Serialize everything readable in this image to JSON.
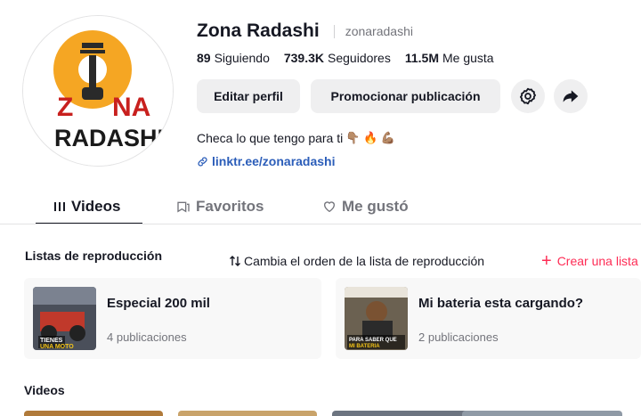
{
  "profile": {
    "display_name": "Zona Radashi",
    "username": "zonaradashi",
    "avatar_text_line1": "Z ON A",
    "avatar_text_line2": "RADASHI"
  },
  "stats": [
    {
      "value": "89",
      "label": "Siguiendo"
    },
    {
      "value": "739.3K",
      "label": "Seguidores"
    },
    {
      "value": "11.5M",
      "label": "Me gusta"
    }
  ],
  "actions": {
    "edit_label": "Editar perfil",
    "promote_label": "Promocionar publicación",
    "settings_icon": "gear-icon",
    "share_icon": "share-arrow-icon"
  },
  "bio": {
    "text": "Checa lo que tengo para ti",
    "emojis": "👇🏽 🔥 💪🏽",
    "link": "linktr.ee/zonaradashi"
  },
  "tabs": [
    {
      "label": "Videos",
      "icon": "grid-icon",
      "active": true
    },
    {
      "label": "Favoritos",
      "icon": "bookmark-icon",
      "active": false
    },
    {
      "label": "Me gustó",
      "icon": "heart-icon",
      "active": false
    }
  ],
  "playlists": {
    "header": "Listas de reproducción",
    "reorder_label": "Cambia el orden de la lista de reproducción",
    "create_label": "Crear una lista",
    "items": [
      {
        "title": "Especial 200 mil",
        "count": "4 publicaciones",
        "thumb_text": "TIENES UNA MOTO"
      },
      {
        "title": "Mi bateria esta cargando?",
        "count": "2 publicaciones",
        "thumb_text": "PARA SABER QUE MI BATERIA"
      }
    ]
  },
  "videos": {
    "header": "Videos"
  },
  "colors": {
    "accent_red": "#fe2c55",
    "link_blue": "#2b5db9",
    "logo_orange": "#f5a623",
    "logo_red": "#c8201e"
  }
}
